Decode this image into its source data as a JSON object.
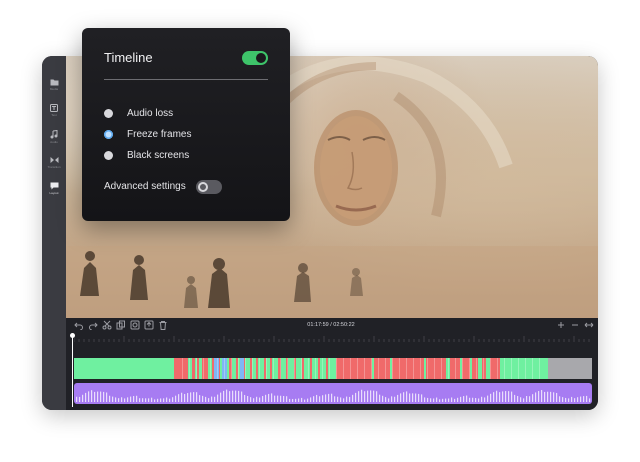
{
  "popup": {
    "title": "Timeline",
    "timeline_enabled": true,
    "options": [
      {
        "label": "Audio loss",
        "selected": false
      },
      {
        "label": "Freeze frames",
        "selected": true
      },
      {
        "label": "Black screens",
        "selected": false
      }
    ],
    "advanced_label": "Advanced settings",
    "advanced_enabled": false
  },
  "sidebar": {
    "items": [
      {
        "icon": "folder-icon",
        "label": "Media"
      },
      {
        "icon": "text-icon",
        "label": "Text"
      },
      {
        "icon": "music-icon",
        "label": "Audio"
      },
      {
        "icon": "transition-icon",
        "label": "Transition"
      },
      {
        "icon": "caption-icon",
        "label": "Layout",
        "active": true
      }
    ]
  },
  "timeline": {
    "time_display": "01:17:59 / 02:50:22",
    "tools_left": [
      "undo-icon",
      "redo-icon",
      "cut-icon",
      "copy-icon",
      "snapshot-icon",
      "export-icon",
      "delete-icon"
    ],
    "tools_right": [
      "zoom-in-icon",
      "zoom-out-icon",
      "fit-icon"
    ]
  },
  "colors": {
    "ok_segment": "#6ff0a0",
    "issue_segment": "#f06a6a",
    "freeze_segment": "#7fb6f5",
    "unanalyzed": "#a8a8ac",
    "audio_track": "#a77cf2",
    "toggle_on": "#3ec46a"
  }
}
